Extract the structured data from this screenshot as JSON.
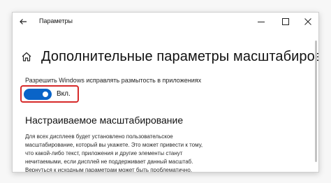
{
  "window": {
    "title": "Параметры",
    "controls": {
      "minimize_icon": "minimize-icon",
      "maximize_icon": "maximize-icon",
      "close_icon": "close-icon"
    }
  },
  "header": {
    "icon": "home-icon",
    "title": "Дополнительные параметры масштабирования"
  },
  "toggle": {
    "caption": "Разрешить Windows исправлять размытость в приложениях",
    "state_label": "Вкл.",
    "is_on": true
  },
  "section": {
    "heading": "Настраиваемое масштабирование",
    "description_lines": [
      "Для всех дисплеев будет установлено пользовательское",
      "масштабирование, который вы укажете. Это может привести к тому,",
      "что какой-либо текст, приложения и другие элементы станут",
      "нечитаемыми, если дисплей не поддерживает данный масштаб.",
      "Вернуться к исходным параметрам может быть проблематично."
    ]
  },
  "colors": {
    "accent": "#0a64c8",
    "highlight": "#d62a2a"
  }
}
